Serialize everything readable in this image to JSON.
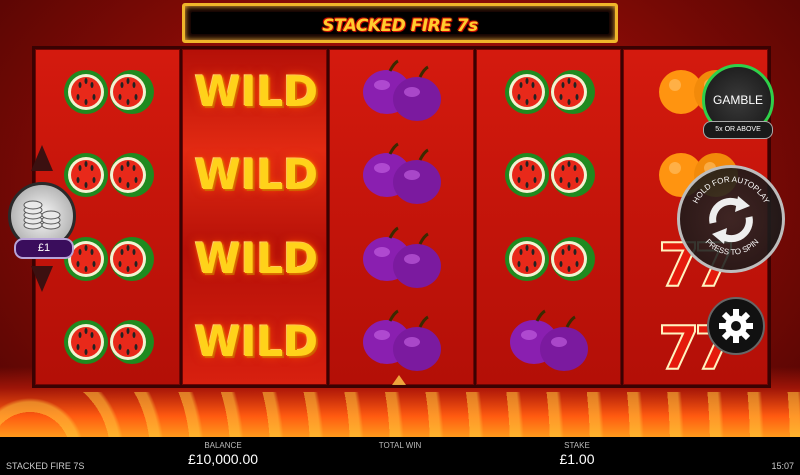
{
  "game": {
    "title": "STACKED FIRE 7s",
    "footer_title": "STACKED FIRE 7S",
    "time": "15:07"
  },
  "reels": [
    [
      "watermelon",
      "watermelon",
      "watermelon",
      "watermelon"
    ],
    [
      "wild",
      "wild",
      "wild",
      "wild"
    ],
    [
      "plum",
      "plum",
      "plum",
      "plum"
    ],
    [
      "watermelon",
      "watermelon",
      "watermelon",
      "plum"
    ],
    [
      "orange",
      "orange",
      "seven",
      "seven"
    ]
  ],
  "wild_label": "WILD",
  "bet": {
    "value": "£1"
  },
  "gamble": {
    "label": "GAMBLE",
    "sub_label": "5x OR ABOVE"
  },
  "spin": {
    "top_text": "HOLD FOR AUTOPLAY",
    "bottom_text": "PRESS TO SPIN"
  },
  "footer": {
    "balance_label": "BALANCE",
    "balance_value": "£10,000.00",
    "total_win_label": "TOTAL WIN",
    "total_win_value": "",
    "stake_label": "STAKE",
    "stake_value": "£1.00"
  },
  "icons": [
    "chip-stack-icon",
    "chevron-up-icon",
    "chevron-down-icon",
    "spin-arrows-icon",
    "gear-icon"
  ],
  "colors": {
    "accent": "#ffcc2e",
    "gamble_ring": "#2fd04a",
    "reel_bg": "#c4140a"
  }
}
